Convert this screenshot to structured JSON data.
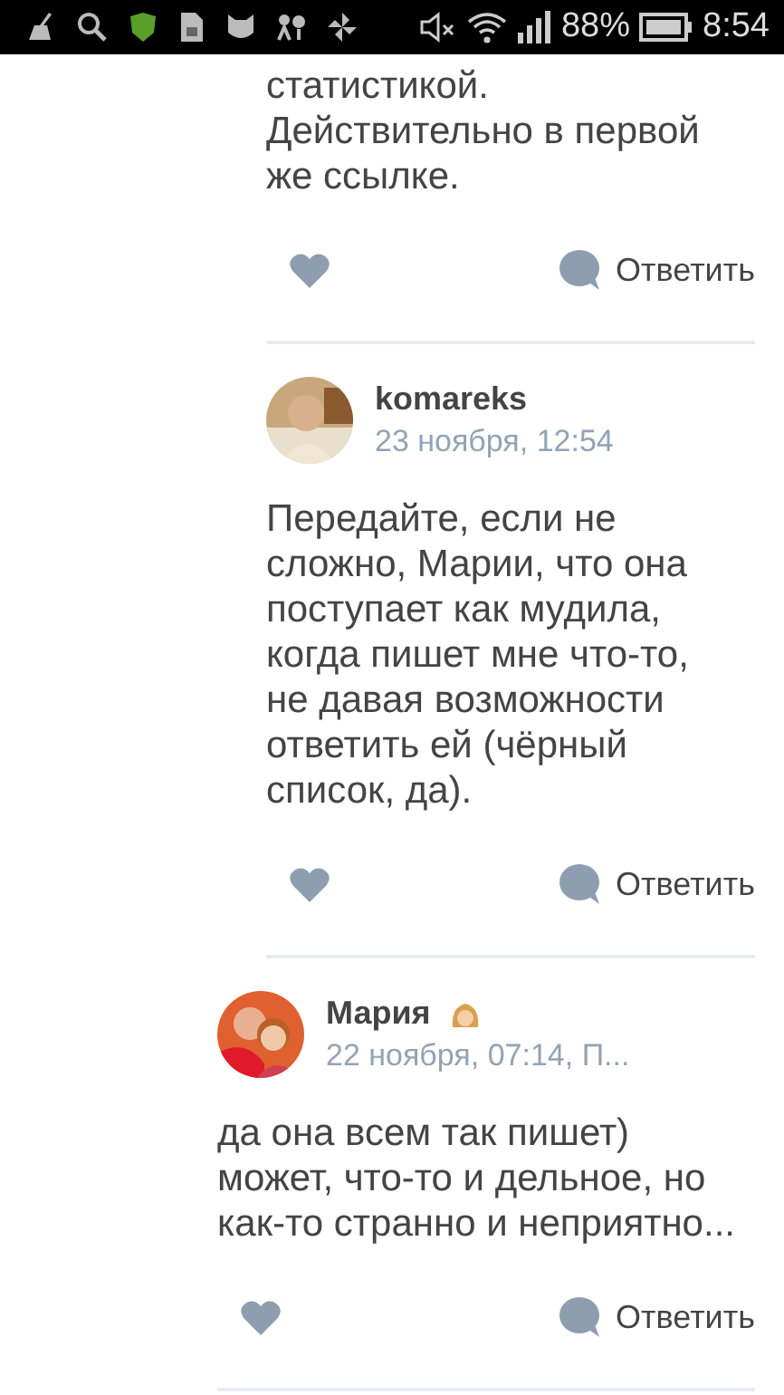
{
  "status_bar": {
    "battery_text": "88%",
    "time": "8:54"
  },
  "comments": [
    {
      "kind": "deep",
      "text": "статистикой. Действительно в первой же ссылке.",
      "liked": false,
      "reply": "Ответить"
    },
    {
      "kind": "deep",
      "author": "komareks",
      "date": "23 ноября, 12:54",
      "text": "Передайте, если не сложно, Марии, что она поступает как мудила, когда пишет мне что-то, не давая возможности ответить ей (чёрный список, да).",
      "liked": false,
      "reply": "Ответить"
    },
    {
      "kind": "shallow",
      "author": "Мария",
      "badge": true,
      "date": "22 ноября, 07:14, П...",
      "text": "да она всем так пишет) может, что-то и дельное, но как-то странно и неприятно...",
      "liked": false,
      "reply": "Ответить"
    }
  ]
}
